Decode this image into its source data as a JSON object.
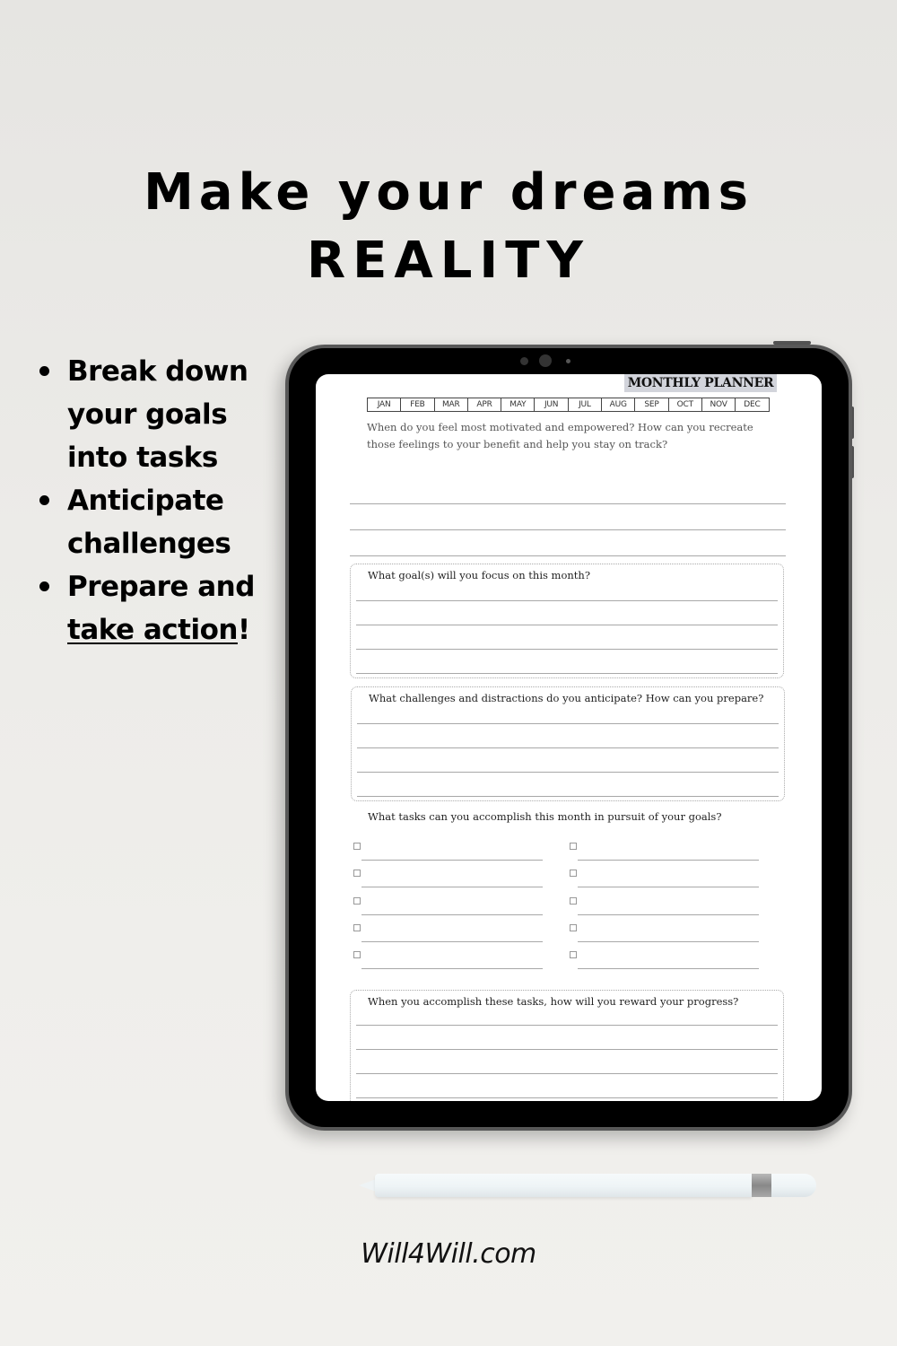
{
  "headline": {
    "line1": "Make your dreams",
    "line2": "REALITY"
  },
  "bullets": [
    {
      "lines": [
        "Break down",
        "your goals",
        "into tasks"
      ]
    },
    {
      "lines": [
        "Anticipate",
        "challenges"
      ]
    },
    {
      "lines": [
        "Prepare and"
      ],
      "underlined": "take action",
      "suffix": "!"
    }
  ],
  "planner": {
    "title": "MONTHLY PLANNER",
    "months": [
      "JAN",
      "FEB",
      "MAR",
      "APR",
      "MAY",
      "JUN",
      "JUL",
      "AUG",
      "SEP",
      "OCT",
      "NOV",
      "DEC"
    ],
    "prompt_motivation": "When do you feel most motivated and empowered? How can you recreate those feelings to your benefit and help you stay on track?",
    "prompt_goals": "What goal(s) will you focus on this month?",
    "prompt_challenges": "What challenges and distractions do you anticipate? How can you prepare?",
    "prompt_tasks": "What tasks can you accomplish this month in pursuit of your goals?",
    "prompt_reward": "When you accomplish these tasks, how will you reward your progress?",
    "task_checkbox_count": 10
  },
  "brand": "Will4Will.com"
}
